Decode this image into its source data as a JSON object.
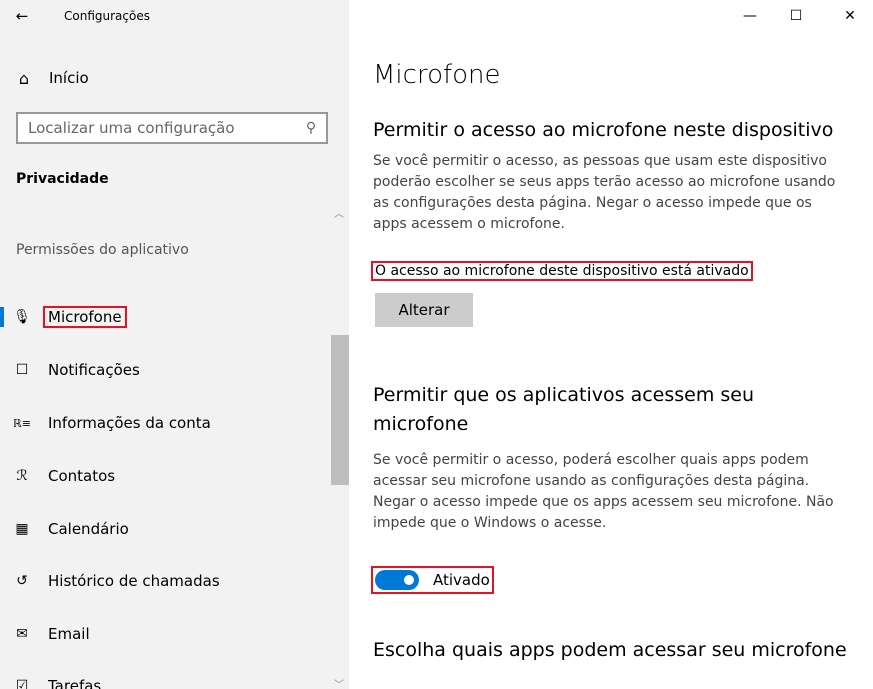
{
  "window": {
    "title": "Configurações",
    "controls": {
      "minimize": "—",
      "maximize": "☐",
      "close": "✕"
    }
  },
  "sidebar": {
    "back_icon": "←",
    "home": {
      "icon": "⌂",
      "label": "Início"
    },
    "search": {
      "placeholder": "Localizar uma configuração",
      "icon": "⚲"
    },
    "section_title": "Privacidade",
    "group_label": "Permissões do aplicativo",
    "scroll_up": "︿",
    "scroll_down": "﹀",
    "items": [
      {
        "icon": "🎙",
        "label": "Microfone"
      },
      {
        "icon": "☐",
        "label": "Notificações"
      },
      {
        "icon": "ℝ≡",
        "label": "Informações da conta"
      },
      {
        "icon": "ℛ",
        "label": "Contatos"
      },
      {
        "icon": "▦",
        "label": "Calendário"
      },
      {
        "icon": "↺",
        "label": "Histórico de chamadas"
      },
      {
        "icon": "✉",
        "label": "Email"
      },
      {
        "icon": "☑",
        "label": "Tarefas"
      }
    ]
  },
  "main": {
    "title": "Microfone",
    "section1": {
      "heading": "Permitir o acesso ao microfone neste dispositivo",
      "description": "Se você permitir o acesso, as pessoas que usam este dispositivo poderão escolher se seus apps terão acesso ao microfone usando as configurações desta página. Negar o acesso impede que os apps acessem o microfone.",
      "status": "O acesso ao microfone deste dispositivo está ativado",
      "button": "Alterar"
    },
    "section2": {
      "heading": "Permitir que os aplicativos acessem seu microfone",
      "description": "Se você permitir o acesso, poderá escolher quais apps podem acessar seu microfone usando as configurações desta página. Negar o acesso impede que os apps acessem seu microfone. Não impede que o Windows o acesse.",
      "toggle_label": "Ativado"
    },
    "section3": {
      "heading": "Escolha quais apps podem acessar seu microfone"
    }
  },
  "colors": {
    "accent": "#0078d7",
    "highlight": "#e81123",
    "sidebar_bg": "#f2f2f2"
  }
}
